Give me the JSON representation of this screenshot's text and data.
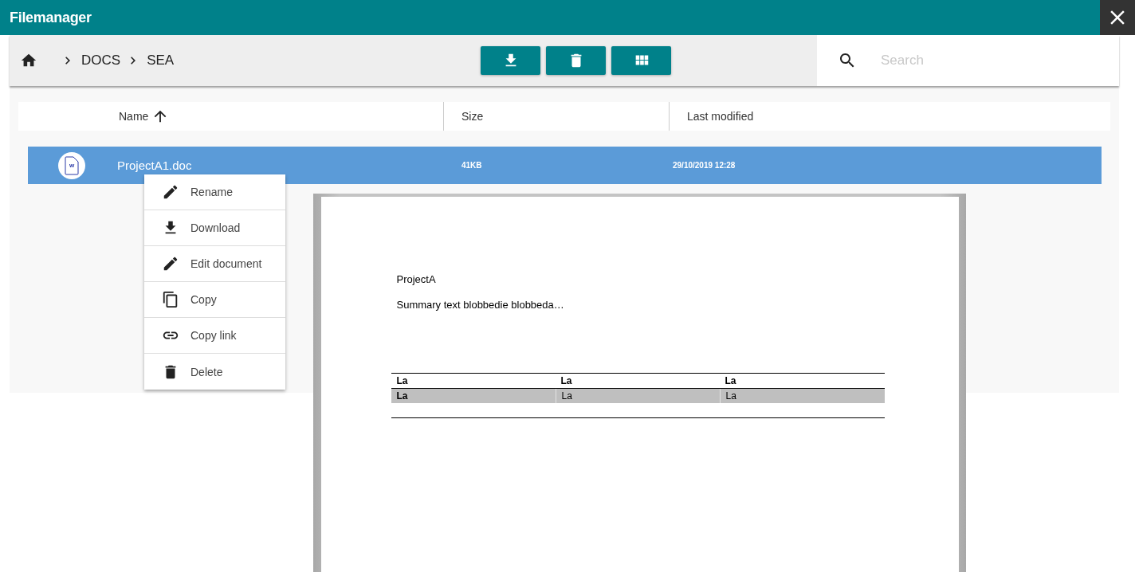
{
  "window": {
    "title": "Filemanager"
  },
  "breadcrumbs": [
    "DOCS",
    "SEA"
  ],
  "toolbar_actions": [
    {
      "kind": "download"
    },
    {
      "kind": "delete"
    },
    {
      "kind": "grid"
    }
  ],
  "search": {
    "placeholder": "Search"
  },
  "table": {
    "columns": [
      {
        "label": "Name",
        "sorted": true
      },
      {
        "label": "Size",
        "sorted": false
      },
      {
        "label": "Last modified",
        "sorted": false
      }
    ],
    "rows": [
      {
        "icon_letter": "w",
        "name": "ProjectA1.doc",
        "size": "41KB",
        "modified": "29/10/2019 12:28",
        "selected": true
      }
    ]
  },
  "context_menu": [
    {
      "kind": "edit",
      "label": "Rename"
    },
    {
      "kind": "download",
      "label": "Download"
    },
    {
      "kind": "edit",
      "label": "Edit document"
    },
    {
      "kind": "copy",
      "label": "Copy"
    },
    {
      "kind": "link",
      "label": "Copy link"
    },
    {
      "kind": "delete",
      "label": "Delete"
    }
  ],
  "preview": {
    "title": "ProjectA",
    "summary": "Summary text blobbedie blobbeda…",
    "table": {
      "header": [
        "La",
        "La",
        "La"
      ],
      "rows": [
        [
          "La",
          "La",
          "La"
        ]
      ]
    }
  }
}
